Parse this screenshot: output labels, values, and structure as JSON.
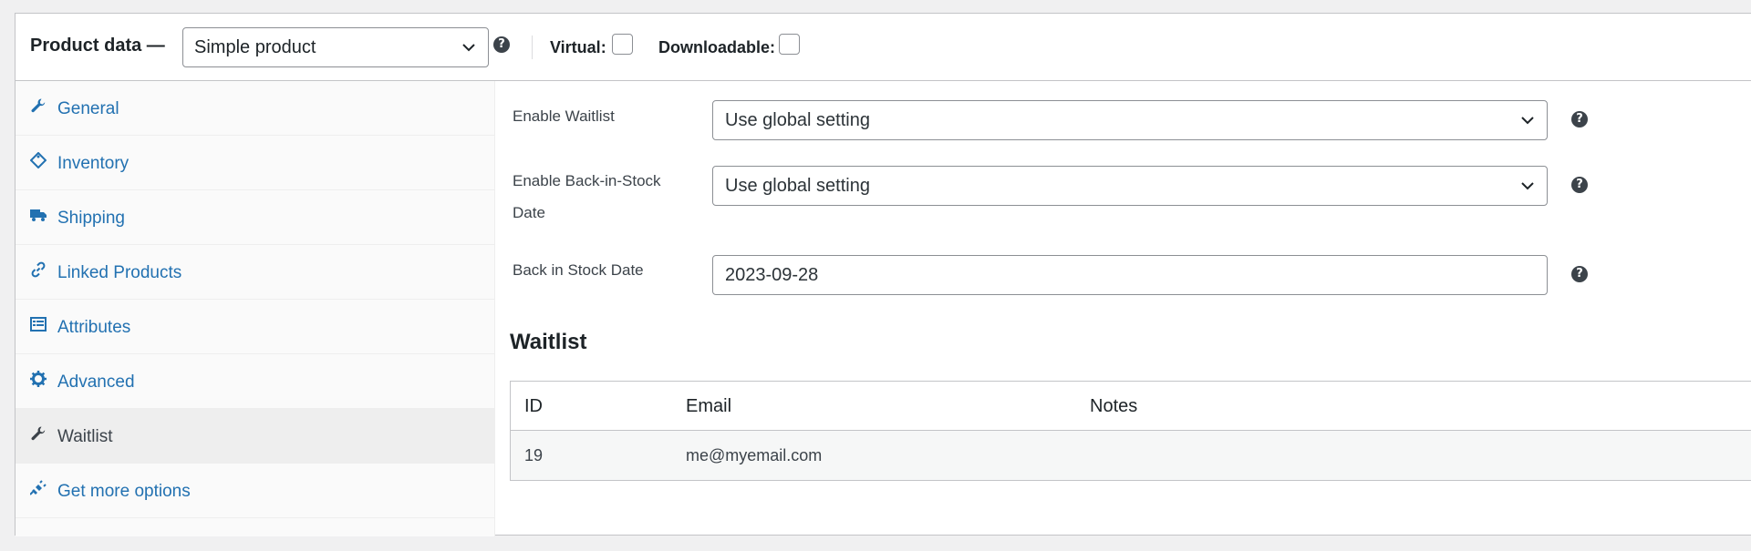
{
  "header": {
    "title": "Product data —",
    "product_type": "Simple product",
    "help_glyph": "?",
    "virtual_label": "Virtual:",
    "downloadable_label": "Downloadable:"
  },
  "sidebar": {
    "items": [
      {
        "label": "General",
        "icon": "wrench-icon"
      },
      {
        "label": "Inventory",
        "icon": "tag-icon"
      },
      {
        "label": "Shipping",
        "icon": "truck-icon"
      },
      {
        "label": "Linked Products",
        "icon": "link-icon"
      },
      {
        "label": "Attributes",
        "icon": "list-view-icon"
      },
      {
        "label": "Advanced",
        "icon": "gear-icon"
      },
      {
        "label": "Waitlist",
        "icon": "wrench-icon",
        "active": true
      },
      {
        "label": "Get more options",
        "icon": "plugin-icon"
      }
    ]
  },
  "waitlist_settings": {
    "enable_waitlist_label": "Enable Waitlist",
    "enable_waitlist_value": "Use global setting",
    "enable_back_in_stock_label_1": "Enable Back-in-Stock",
    "enable_back_in_stock_label_2": "Date",
    "enable_back_in_stock_value": "Use global setting",
    "back_in_stock_date_label": "Back in Stock Date",
    "back_in_stock_date_value": "2023-09-28"
  },
  "waitlist_table": {
    "title": "Waitlist",
    "columns": [
      "ID",
      "Email",
      "Notes"
    ],
    "rows": [
      {
        "id": "19",
        "email": "me@myemail.com",
        "notes": ""
      }
    ]
  },
  "colors": {
    "link": "#2271b1",
    "active_bg": "#eeeeee",
    "border": "#c3c4c7"
  }
}
